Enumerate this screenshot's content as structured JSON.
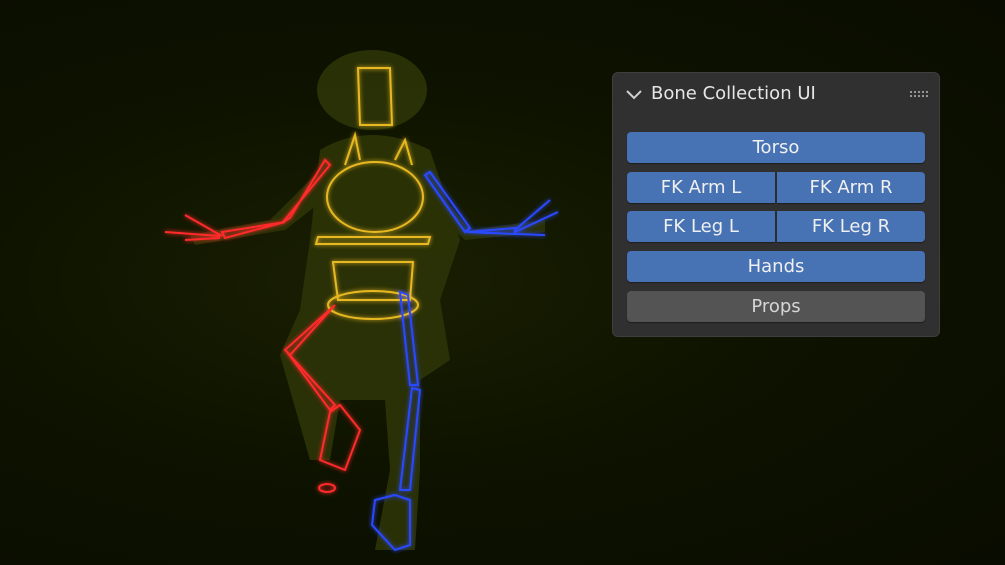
{
  "panel": {
    "title": "Bone Collection UI",
    "collapse_icon": "chevron-down-icon",
    "drag_icon": "grip-dots-icon",
    "buttons": {
      "torso": "Torso",
      "fk_arm_l": "FK Arm L",
      "fk_arm_r": "FK Arm R",
      "fk_leg_l": "FK Leg L",
      "fk_leg_r": "FK Leg R",
      "hands": "Hands",
      "props": "Props"
    }
  },
  "colors": {
    "active_button": "#4772b3",
    "inactive_button": "#545454",
    "panel_bg": "#303030",
    "bone_left": "#ff2a2a",
    "bone_right": "#2a4aff",
    "bone_center": "#e8b820"
  }
}
